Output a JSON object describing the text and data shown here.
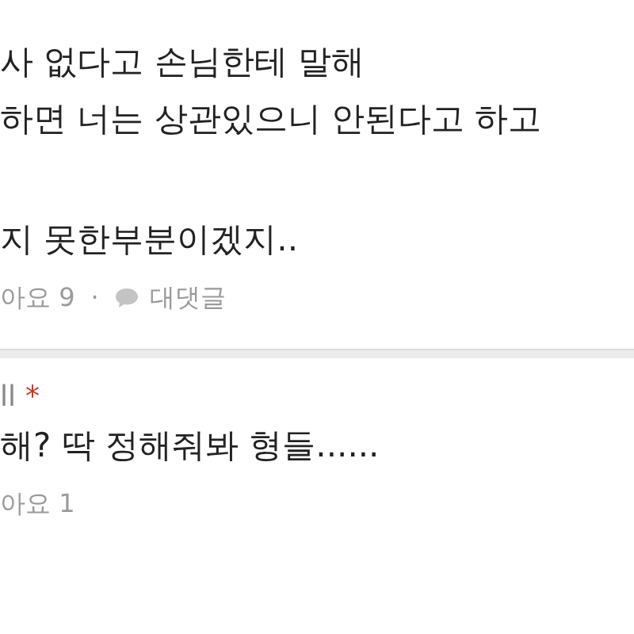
{
  "comments": [
    {
      "paragraphs": [
        [
          "사 없다고 손님한테 말해",
          "하면 너는 상관있으니 안된다고 하고"
        ],
        [
          "지 못한부분이겠지.."
        ]
      ],
      "likes": "아요 9",
      "separator": "·",
      "reply": "대댓글"
    },
    {
      "author": "ll",
      "author_mark": "*",
      "paragraphs": [
        [
          "해? 딱 정해줘봐 형들......"
        ]
      ],
      "likes": "아요 1"
    }
  ]
}
